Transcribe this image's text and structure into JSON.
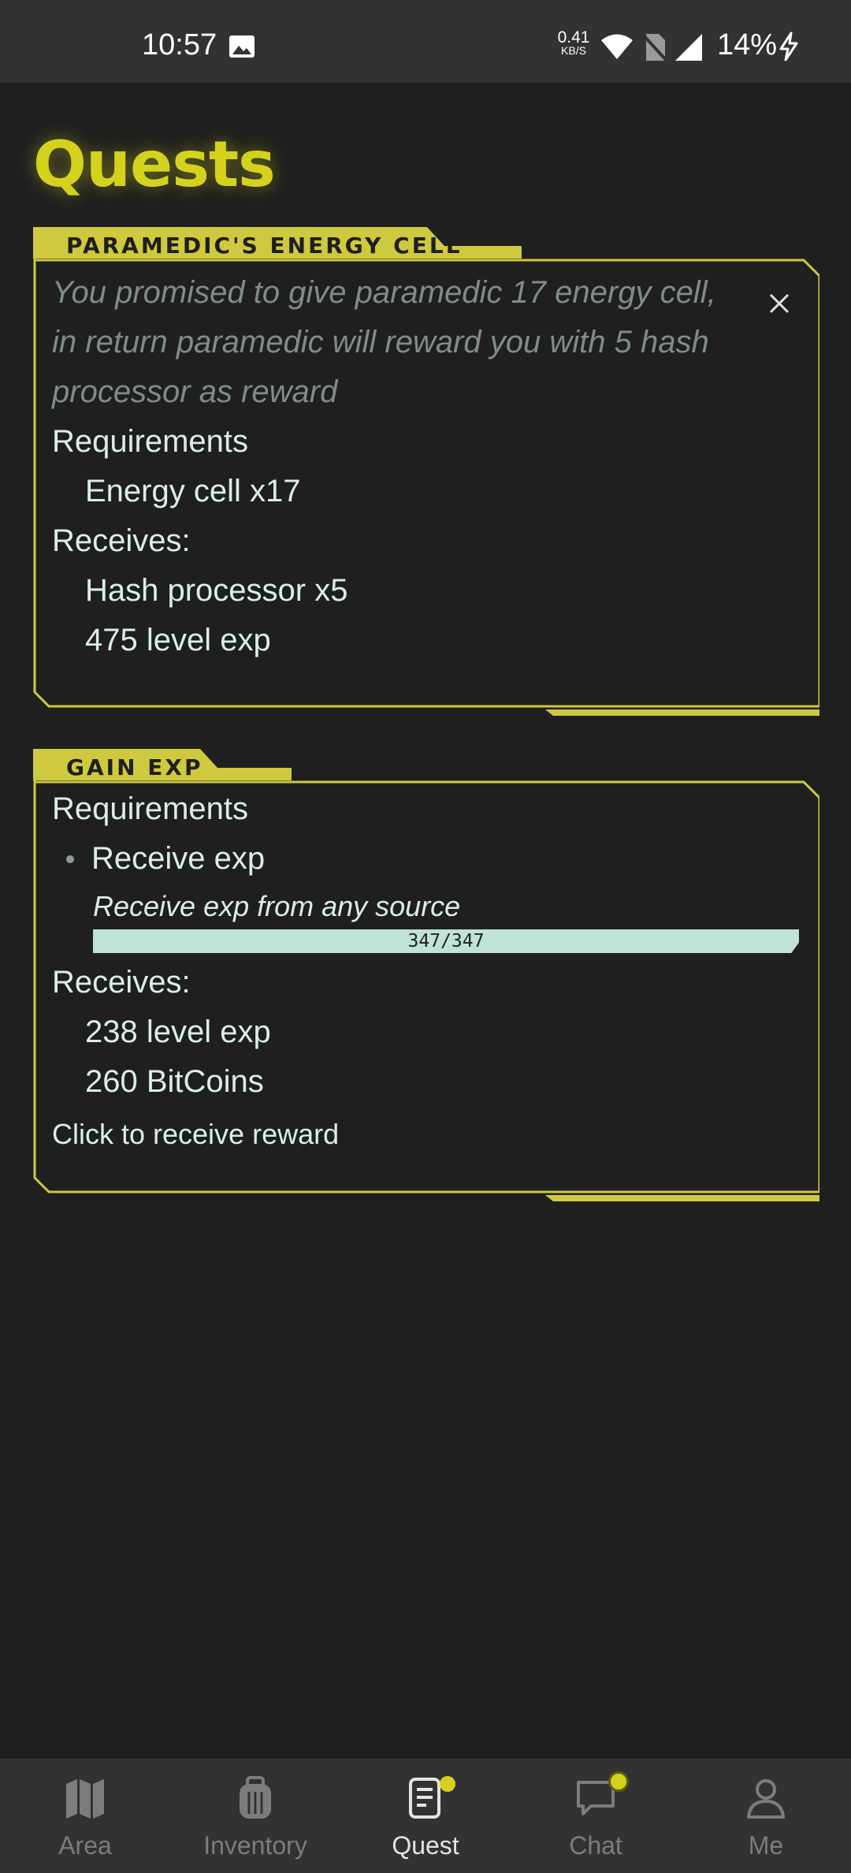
{
  "status": {
    "time": "10:57",
    "net_speed_value": "0.41",
    "net_speed_unit": "KB/S",
    "battery": "14%",
    "icons": [
      "gallery-icon",
      "wifi-icon",
      "no-sim-icon",
      "signal-icon",
      "charging-bolt-icon"
    ]
  },
  "page": {
    "title": "Quests"
  },
  "quests": [
    {
      "tab_label": "PARAMEDIC'S ENERGY CELL",
      "description": "You promised to give paramedic 17 energy cell, in return paramedic will reward you with 5 hash processor as reward",
      "requirements_label": "Requirements",
      "requirements": [
        "Energy cell x17"
      ],
      "receives_label": "Receives:",
      "rewards": [
        "Hash processor x5",
        "475 level exp"
      ]
    },
    {
      "tab_label": "GAIN EXP",
      "requirements_label": "Requirements",
      "requirement_item": "Receive exp",
      "requirement_detail": "Receive exp from any source",
      "progress_text": "347/347",
      "progress_fraction": 1.0,
      "receives_label": "Receives:",
      "rewards": [
        "238 level exp",
        "260 BitCoins"
      ],
      "action_label": "Click to receive reward"
    }
  ],
  "nav": {
    "items": [
      {
        "label": "Area",
        "icon": "map-icon"
      },
      {
        "label": "Inventory",
        "icon": "backpack-icon"
      },
      {
        "label": "Quest",
        "icon": "quest-document-icon"
      },
      {
        "label": "Chat",
        "icon": "chat-bubble-icon"
      },
      {
        "label": "Me",
        "icon": "person-icon"
      }
    ],
    "active": "Quest"
  },
  "colors": {
    "accent": "#d4d21d",
    "background": "#1f1f1f",
    "text": "#d9efe6",
    "muted_text": "#7e8d88",
    "progress": "#bfe3d8"
  }
}
